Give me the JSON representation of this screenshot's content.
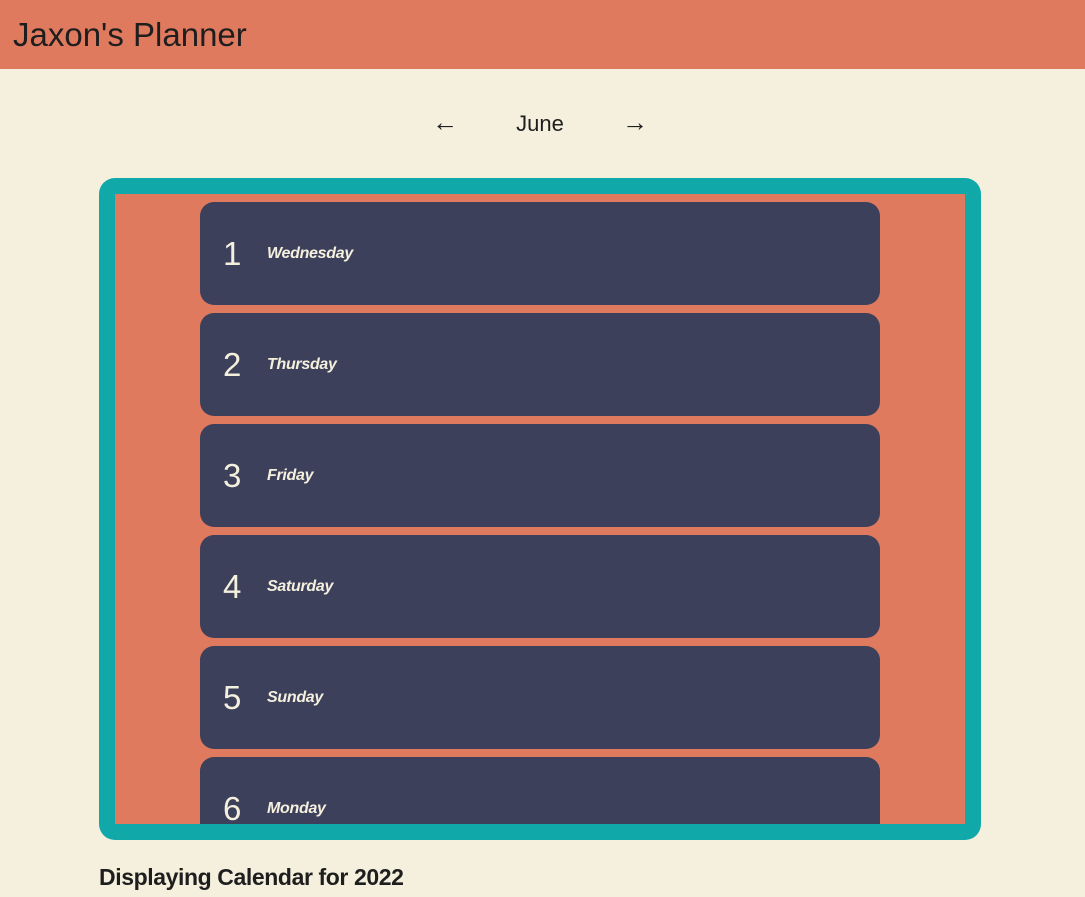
{
  "header": {
    "title": "Jaxon's Planner"
  },
  "nav": {
    "prev_arrow": "←",
    "month": "June",
    "next_arrow": "→"
  },
  "days": [
    {
      "number": "1",
      "name": "Wednesday"
    },
    {
      "number": "2",
      "name": "Thursday"
    },
    {
      "number": "3",
      "name": "Friday"
    },
    {
      "number": "4",
      "name": "Saturday"
    },
    {
      "number": "5",
      "name": "Sunday"
    },
    {
      "number": "6",
      "name": "Monday"
    }
  ],
  "footer": {
    "caption": "Displaying Calendar for 2022"
  },
  "colors": {
    "background": "#f4f0dd",
    "header": "#e07a5f",
    "frame": "#11a8aa",
    "card": "#3d405b"
  }
}
